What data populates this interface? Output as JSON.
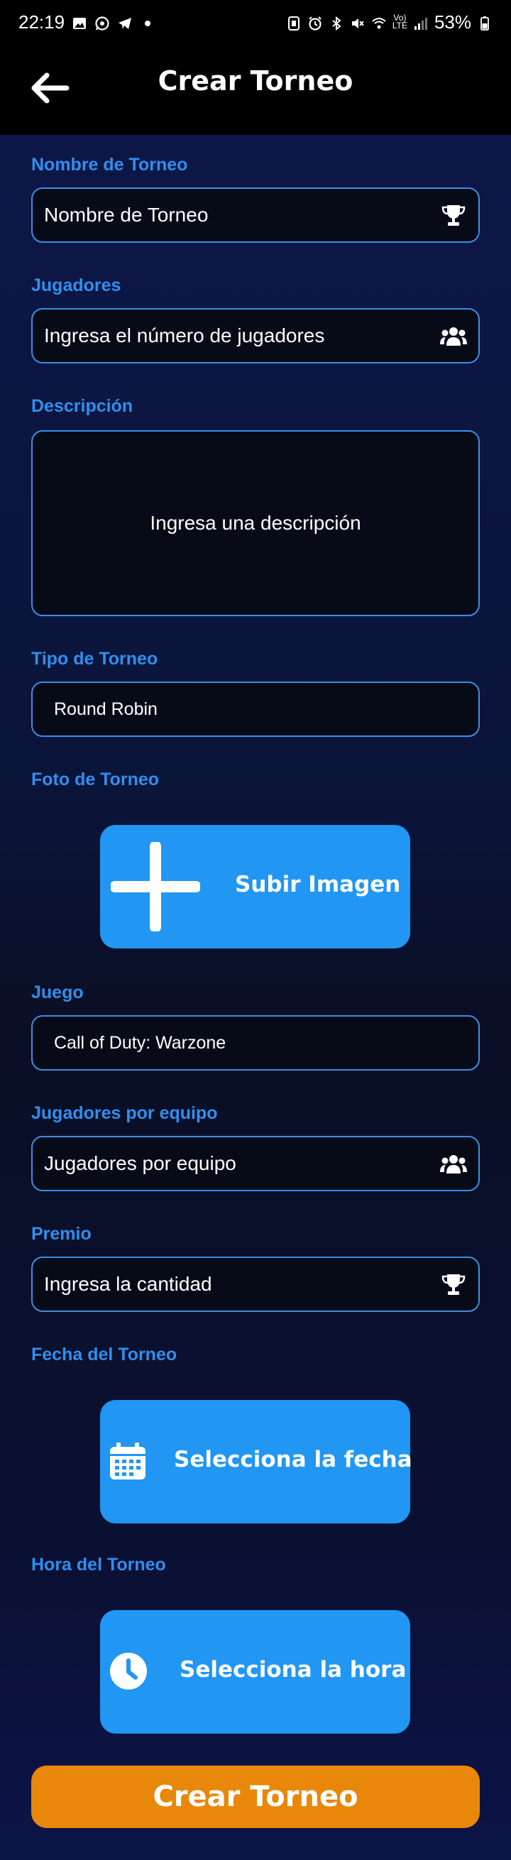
{
  "status_bar": {
    "time": "22:19",
    "battery": "53%",
    "icons_left": [
      "gallery-icon",
      "whatsapp-icon",
      "telegram-icon",
      "dot-icon"
    ],
    "icons_right": [
      "nfc-icon",
      "alarm-icon",
      "bluetooth-icon",
      "mute-icon",
      "wifi-icon",
      "volte-icon",
      "signal-icon",
      "battery-icon"
    ]
  },
  "app_bar": {
    "back_icon": "arrow-left-icon",
    "title": "Crear Torneo"
  },
  "form": {
    "nombre": {
      "label": "Nombre de Torneo",
      "placeholder": "Nombre de Torneo",
      "icon": "trophy-icon"
    },
    "jugadores": {
      "label": "Jugadores",
      "placeholder": "Ingresa el número de jugadores",
      "icon": "users-icon"
    },
    "descripcion": {
      "label": "Descripción",
      "placeholder": "Ingresa una descripción"
    },
    "tipo": {
      "label": "Tipo de Torneo",
      "value": "Round Robin"
    },
    "foto": {
      "label": "Foto de Torneo",
      "button_label": "Subir Imagen",
      "icon": "plus-icon"
    },
    "juego": {
      "label": "Juego",
      "value": "Call of Duty: Warzone"
    },
    "jugadores_equipo": {
      "label": "Jugadores por equipo",
      "placeholder": "Jugadores por equipo",
      "icon": "users-icon"
    },
    "premio": {
      "label": "Premio",
      "placeholder": "Ingresa la cantidad",
      "icon": "trophy-icon"
    },
    "fecha": {
      "label": "Fecha del Torneo",
      "button_label": "Selecciona la fecha",
      "icon": "calendar-icon"
    },
    "hora": {
      "label": "Hora del Torneo",
      "button_label": "Selecciona la hora",
      "icon": "clock-icon"
    }
  },
  "submit_label": "Crear Torneo",
  "colors": {
    "accent_blue": "#2196f3",
    "label_blue": "#2f8ff0",
    "submit_orange": "#e8870a",
    "background": "#0a1030"
  }
}
